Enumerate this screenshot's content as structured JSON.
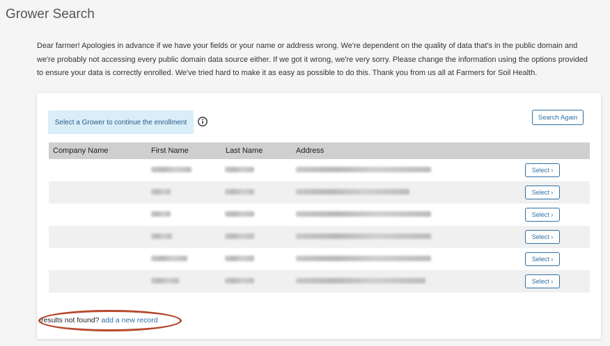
{
  "page": {
    "title": "Grower Search",
    "intro": "Dear farmer! Apologies in advance if we have your fields or your name or address wrong. We're dependent on the quality of data that's in the public domain and we're probably not accessing every public domain data source either. If we got it wrong, we're very sorry. Please change the information using the options provided to ensure your data is correctly enrolled. We've tried hard to make it as easy as possible to do this. Thank you from us all at Farmers for Soil Health."
  },
  "card": {
    "alert": "Select a Grower to continue the enrollment",
    "search_again_label": "Search Again",
    "columns": [
      "Company Name",
      "First Name",
      "Last Name",
      "Address"
    ],
    "select_label": "Select ›",
    "rows": [
      {
        "company": "",
        "first": "",
        "last": "",
        "address": ""
      },
      {
        "company": "",
        "first": "",
        "last": "",
        "address": ""
      },
      {
        "company": "",
        "first": "",
        "last": "",
        "address": ""
      },
      {
        "company": "",
        "first": "",
        "last": "",
        "address": ""
      },
      {
        "company": "",
        "first": "",
        "last": "",
        "address": ""
      },
      {
        "company": "",
        "first": "",
        "last": "",
        "address": ""
      }
    ],
    "not_found_text": "results not found?",
    "add_record_link": "add a new record"
  },
  "colors": {
    "accent": "#2d6fa3",
    "alert_bg": "#d9eef8",
    "header_bg": "#cfcfcf",
    "annotation": "#b5492e"
  }
}
